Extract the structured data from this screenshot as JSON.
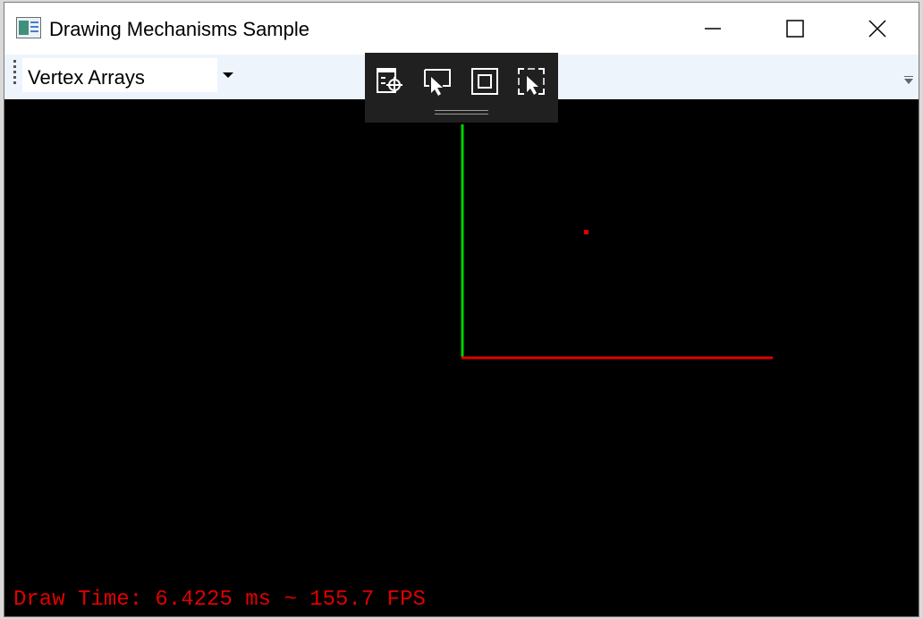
{
  "window": {
    "title": "Drawing Mechanisms Sample",
    "icon": "app-window-icon",
    "caption_buttons": [
      "minimize-icon",
      "maximize-icon",
      "close-icon"
    ]
  },
  "toolbar": {
    "mechanism_select": {
      "value": "Vertex Arrays",
      "icon": "chevron-down-icon"
    },
    "overflow_icon": "toolbar-overflow-icon"
  },
  "debug_toolbar": {
    "buttons": [
      {
        "icon": "select-element-icon"
      },
      {
        "icon": "pointer-icon"
      },
      {
        "icon": "element-bounds-icon"
      },
      {
        "icon": "track-focus-icon"
      }
    ]
  },
  "scene": {
    "background": "#000000",
    "y_axis_color": "#00d000",
    "x_axis_color": "#e00000",
    "point_color": "#e00000"
  },
  "status": {
    "draw_time": "Draw Time: 6.4225 ms ~ 155.7 FPS",
    "color": "#e00000"
  }
}
